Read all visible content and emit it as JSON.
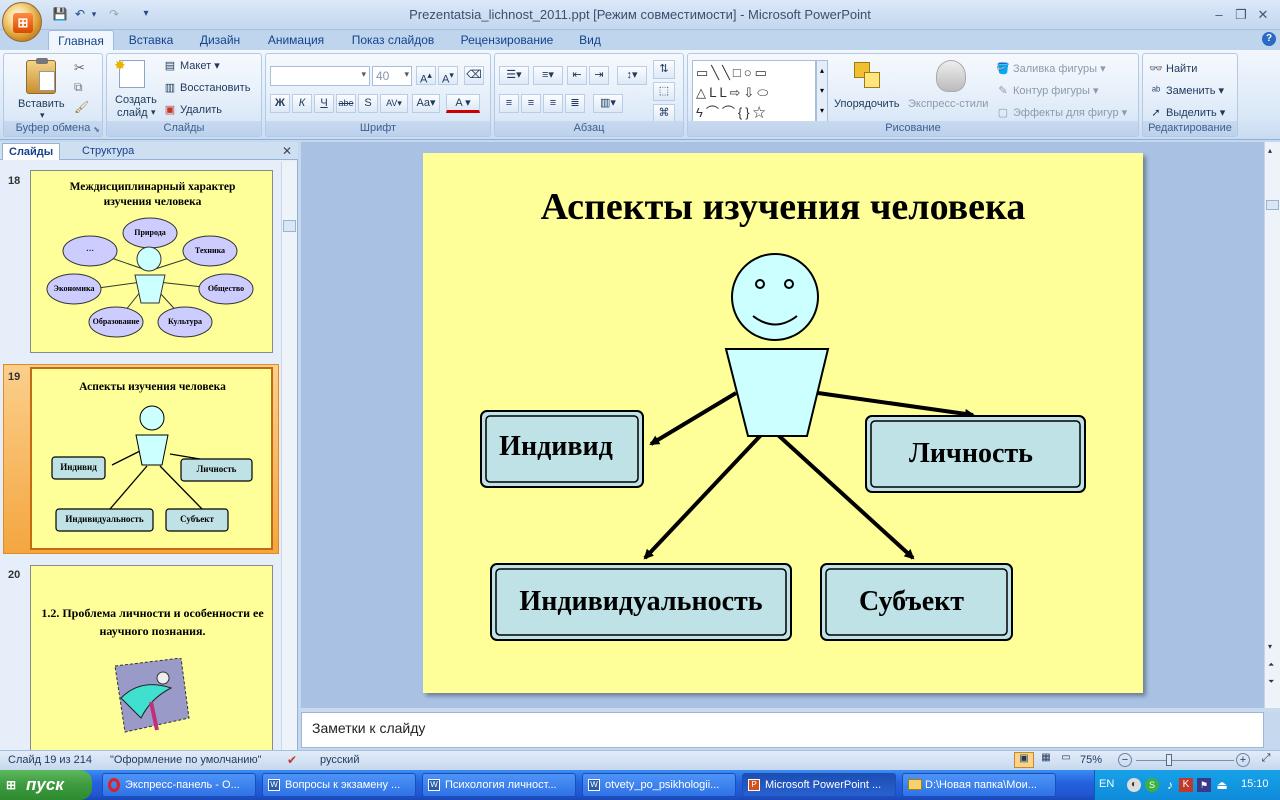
{
  "window": {
    "title": "Prezentatsia_lichnost_2011.ppt [Режим совместимости] - Microsoft PowerPoint",
    "minimize": "–",
    "restore": "❐",
    "close": "✕"
  },
  "quick_access": [
    "save-icon",
    "undo-icon",
    "redo-icon",
    "customize-icon"
  ],
  "ribbon_tabs": [
    "Главная",
    "Вставка",
    "Дизайн",
    "Анимация",
    "Показ слайдов",
    "Рецензирование",
    "Вид"
  ],
  "ribbon": {
    "clipboard": {
      "label": "Буфер обмена",
      "paste": "Вставить"
    },
    "slides": {
      "label": "Слайды",
      "new_slide_1": "Создать",
      "new_slide_2": "слайд",
      "layout": "Макет",
      "reset": "Восстановить",
      "delete": "Удалить"
    },
    "font": {
      "label": "Шрифт",
      "font_name": "",
      "font_size": "40"
    },
    "paragraph": {
      "label": "Абзац"
    },
    "drawing": {
      "label": "Рисование",
      "arrange": "Упорядочить",
      "quick_styles": "Экспресс-стили",
      "fill": "Заливка фигуры",
      "outline": "Контур фигуры",
      "effects": "Эффекты для фигур"
    },
    "editing": {
      "label": "Редактирование",
      "find": "Найти",
      "replace": "Заменить",
      "select": "Выделить"
    }
  },
  "pane_tabs": {
    "slides": "Слайды",
    "outline": "Структура"
  },
  "thumbnails": [
    {
      "num": "18",
      "title": "Междисциплинарный характер изучения человека",
      "ellipses": [
        "…",
        "Природа",
        "Техника",
        "Экономика",
        "Общество",
        "Образование",
        "Культура"
      ]
    },
    {
      "num": "19",
      "title": "Аспекты изучения человека",
      "boxes": [
        "Индивид",
        "Личность",
        "Индивидуальность",
        "Субъект"
      ]
    },
    {
      "num": "20",
      "title": "1.2. Проблема личности и особенности ее научного познания."
    }
  ],
  "slide": {
    "title": "Аспекты изучения человека",
    "boxes": {
      "individ": "Индивид",
      "lichnost": "Личность",
      "individualnost": "Индивидуальность",
      "subekt": "Субъект"
    }
  },
  "notes": {
    "placeholder": "Заметки к слайду"
  },
  "status": {
    "slide_counter": "Слайд 19 из 214",
    "theme": "\"Оформление по умолчанию\"",
    "language": "русский",
    "zoom": "75%"
  },
  "taskbar": {
    "start": "пуск",
    "tasks": [
      "Экспресс-панель - О...",
      "Вопросы к экзамену ...",
      "Психология личност...",
      "otvety_po_psikhologii...",
      "Microsoft PowerPoint ...",
      "D:\\Новая папка\\Мои..."
    ],
    "lang": "EN",
    "clock": "15:10"
  }
}
